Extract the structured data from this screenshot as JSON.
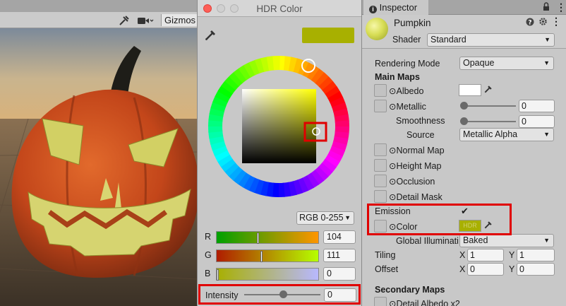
{
  "scene": {
    "toolbar": {
      "gizmos_label": "Gizmos"
    }
  },
  "hdr_color": {
    "title": "HDR Color",
    "swatch_color": "#a8b000",
    "mode": "RGB 0-255",
    "channels": [
      {
        "label": "R",
        "value": "104",
        "fraction": 0.41
      },
      {
        "label": "G",
        "value": "111",
        "fraction": 0.44
      },
      {
        "label": "B",
        "value": "0",
        "fraction": 0.0
      }
    ],
    "intensity": {
      "label": "Intensity",
      "value": "0",
      "fraction": 0.5
    }
  },
  "inspector": {
    "tab_label": "Inspector",
    "object_name": "Pumpkin",
    "shader_label": "Shader",
    "shader_value": "Standard",
    "rendering_mode_label": "Rendering Mode",
    "rendering_mode_value": "Opaque",
    "main_maps_title": "Main Maps",
    "albedo_label": "Albedo",
    "metallic_label": "Metallic",
    "metallic_value": "0",
    "smoothness_label": "Smoothness",
    "smoothness_value": "0",
    "source_label": "Source",
    "source_value": "Metallic Alpha",
    "normal_map_label": "Normal Map",
    "height_map_label": "Height Map",
    "occlusion_label": "Occlusion",
    "detail_mask_label": "Detail Mask",
    "emission_label": "Emission",
    "emission_checked": true,
    "color_label": "Color",
    "color_hdr_badge": "HDR",
    "emission_color": "#a8b000",
    "gi_label": "Global Illuminati",
    "gi_value": "Baked",
    "tiling_label": "Tiling",
    "tiling_x": "1",
    "tiling_y": "1",
    "offset_label": "Offset",
    "offset_x": "0",
    "offset_y": "0",
    "x_label": "X",
    "y_label": "Y",
    "secondary_maps_title": "Secondary Maps",
    "detail_albedo_label": "Detail Albedo x2"
  }
}
